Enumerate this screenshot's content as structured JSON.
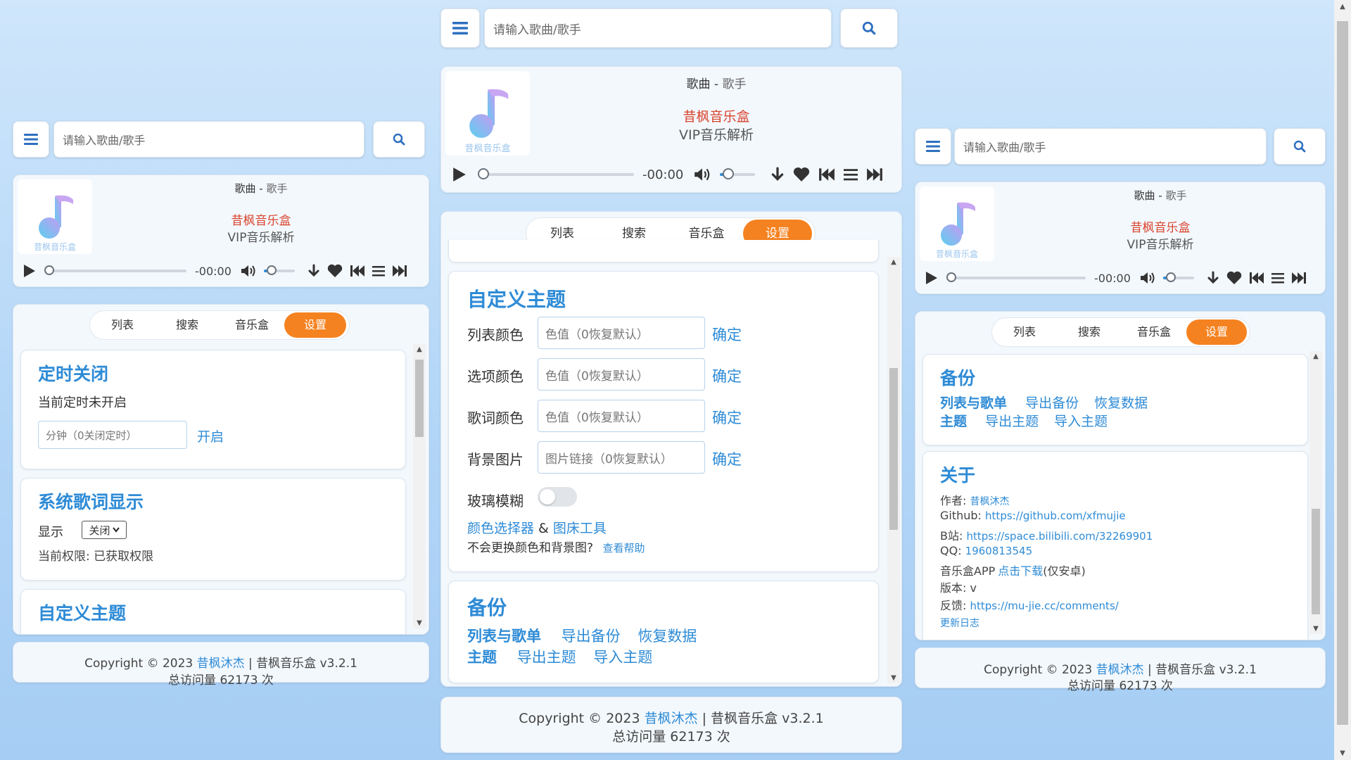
{
  "search_placeholder": "请输入歌曲/歌手",
  "player": {
    "song": "歌曲",
    "sep": " - ",
    "artist": "歌手",
    "app_name": "昔枫音乐盒",
    "subtitle": "VIP音乐解析",
    "cover_text": "昔枫音乐盒",
    "time": "-00:00"
  },
  "tabs": [
    "列表",
    "搜索",
    "音乐盒",
    "设置"
  ],
  "left": {
    "timer": {
      "title": "定时关闭",
      "status": "当前定时未开启",
      "placeholder": "分钟（0关闭定时）",
      "button": "开启"
    },
    "lyrics": {
      "title": "系统歌词显示",
      "label": "显示",
      "selected": "关闭",
      "permission": "当前权限: 已获取权限"
    },
    "theme_title": "自定义主题"
  },
  "center": {
    "theme": {
      "title": "自定义主题",
      "rows": [
        {
          "label": "列表颜色",
          "placeholder": "色值（0恢复默认）",
          "button": "确定"
        },
        {
          "label": "选项颜色",
          "placeholder": "色值（0恢复默认）",
          "button": "确定"
        },
        {
          "label": "歌词颜色",
          "placeholder": "色值（0恢复默认）",
          "button": "确定"
        },
        {
          "label": "背景图片",
          "placeholder": "图片链接（0恢复默认）",
          "button": "确定"
        }
      ],
      "glass_label": "玻璃模糊",
      "link_color_picker": "颜色选择器",
      "amp": " & ",
      "link_image_tool": "图床工具",
      "help_text": "不会更换颜色和背景图?",
      "help_link": "查看帮助"
    }
  },
  "backup": {
    "title": "备份",
    "row1_label": "列表与歌单",
    "export_backup": "导出备份",
    "restore_data": "恢复数据",
    "row2_label": "主题",
    "export_theme": "导出主题",
    "import_theme": "导入主题"
  },
  "about": {
    "title": "关于",
    "author_label": "作者:",
    "author": "昔枫沐杰",
    "github_label": "Github:",
    "github": "https://github.com/xfmujie",
    "bili_label": "B站:",
    "bili": "https://space.bilibili.com/32269901",
    "qq_label": "QQ:",
    "qq": "1960813545",
    "app_label": "音乐盒APP",
    "app_link": "点击下载",
    "app_note": "(仅安卓)",
    "version": "版本: v",
    "feedback_label": "反馈:",
    "feedback": "https://mu-jie.cc/comments/",
    "changelog": "更新日志"
  },
  "footer": {
    "copyright": "Copyright © 2023 ",
    "author": "昔枫沐杰",
    "rest": " | 昔枫音乐盒 v3.2.1",
    "visits": "总访问量 62173 次"
  },
  "colors": {
    "accent": "#2e8bd6",
    "active_tab": "#f58220",
    "brand_red": "#d9442d"
  }
}
